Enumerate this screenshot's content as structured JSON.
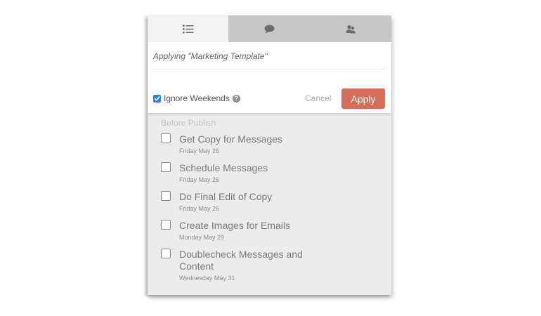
{
  "tabs": [
    {
      "icon": "list-icon",
      "active": true
    },
    {
      "icon": "chat-bubble-icon",
      "active": false
    },
    {
      "icon": "people-icon",
      "active": false
    }
  ],
  "apply": {
    "applying_text": "Applying \"Marketing Template\"",
    "ignore_weekends_label": "Ignore Weekends",
    "ignore_weekends_checked": true,
    "help_glyph": "?",
    "cancel_label": "Cancel",
    "apply_label": "Apply"
  },
  "section": {
    "title": "Before Publish",
    "tasks": [
      {
        "title": "Get Copy for Messages",
        "date": "Friday May 26",
        "checked": false
      },
      {
        "title": "Schedule Messages",
        "date": "Friday May 26",
        "checked": false
      },
      {
        "title": "Do Final Edit of Copy",
        "date": "Friday May 26",
        "checked": false
      },
      {
        "title": "Create Images for Emails",
        "date": "Monday May 29",
        "checked": false
      },
      {
        "title": "Doublecheck Messages and Content",
        "date": "Wednesday May 31",
        "checked": false
      }
    ]
  },
  "colors": {
    "accent_apply": "#d46e57",
    "checkbox_blue": "#2f7de1",
    "tab_active": "#f3f3f3",
    "tab_inactive": "#c7c7c7",
    "panel_bg": "#ececec"
  }
}
